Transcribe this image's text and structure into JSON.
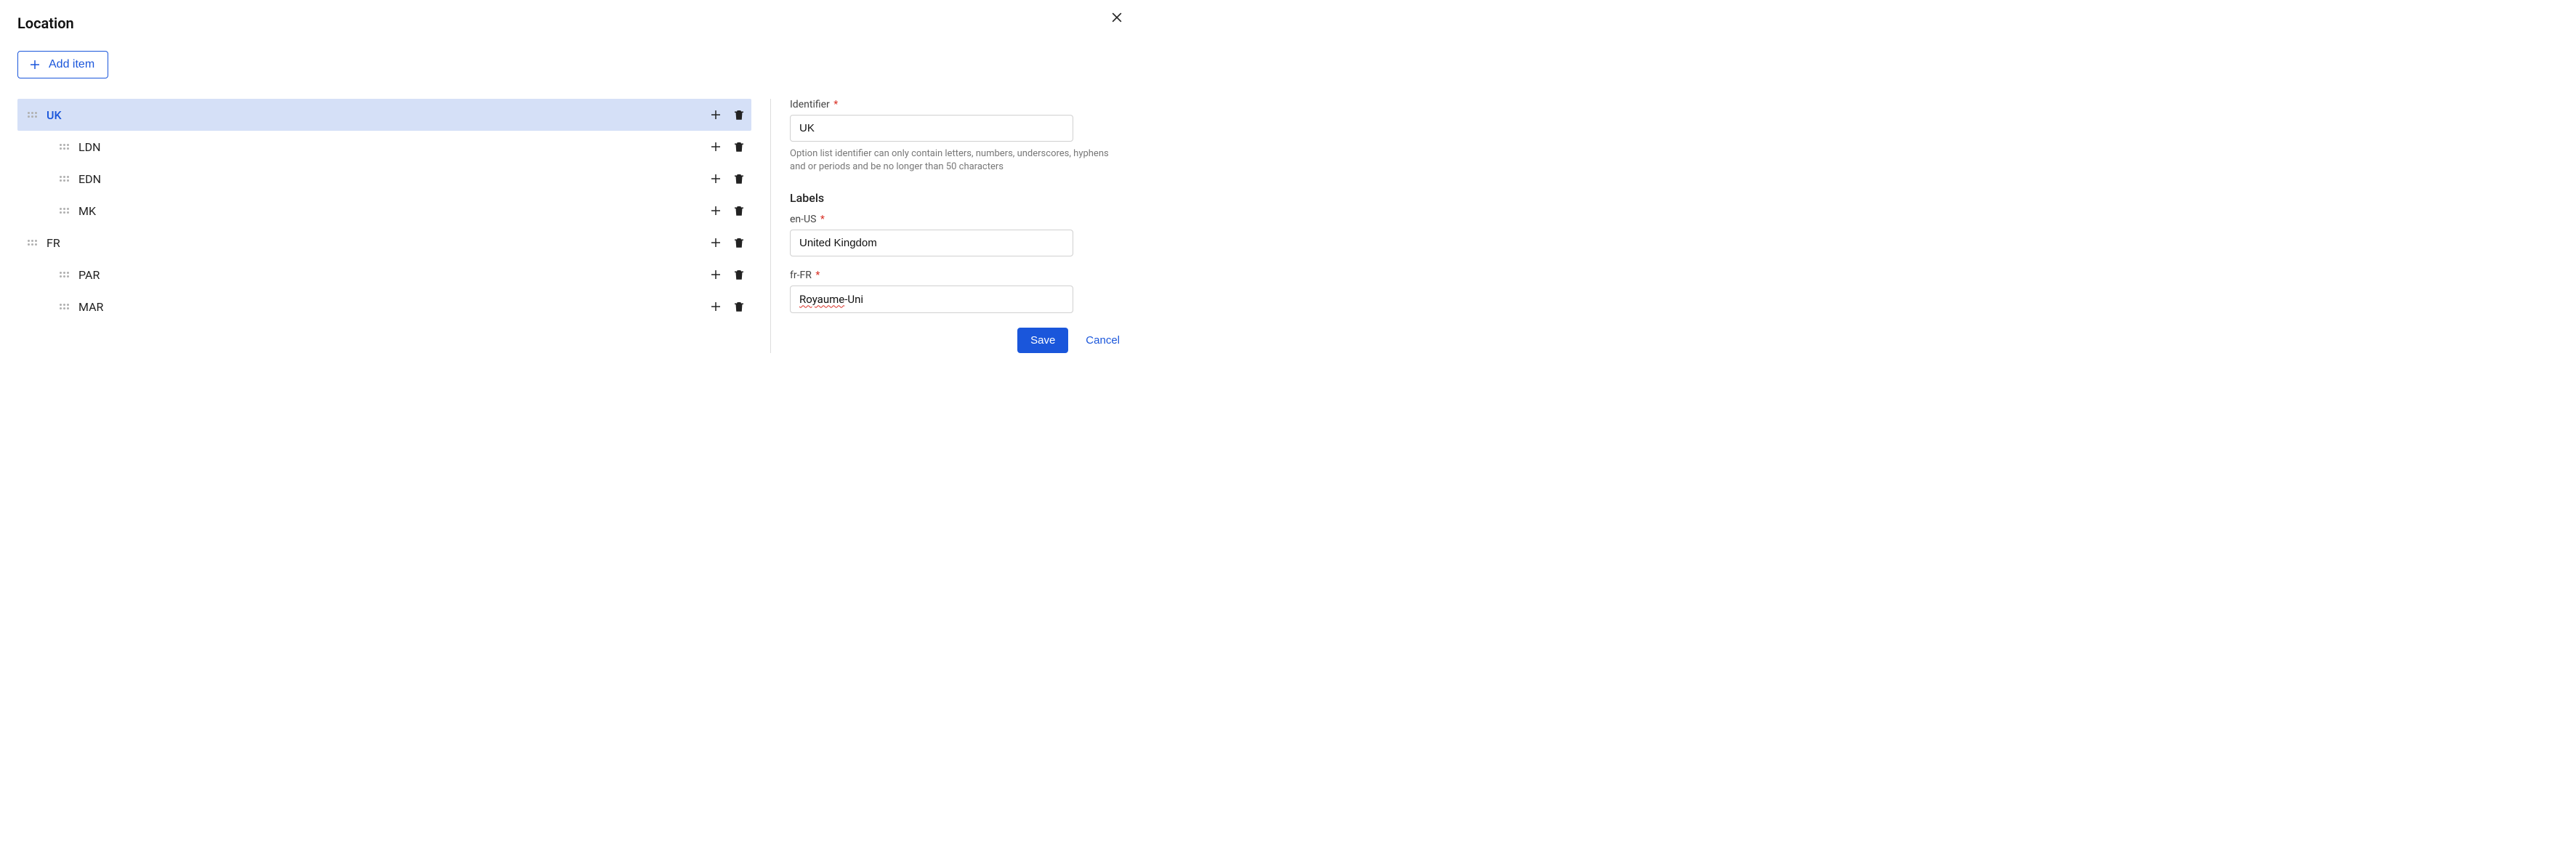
{
  "title": "Location",
  "add_item_label": "Add item",
  "tree": [
    {
      "id": "UK",
      "level": 0,
      "selected": true
    },
    {
      "id": "LDN",
      "level": 1,
      "selected": false
    },
    {
      "id": "EDN",
      "level": 1,
      "selected": false
    },
    {
      "id": "MK",
      "level": 1,
      "selected": false
    },
    {
      "id": "FR",
      "level": 0,
      "selected": false
    },
    {
      "id": "PAR",
      "level": 1,
      "selected": false
    },
    {
      "id": "MAR",
      "level": 1,
      "selected": false
    }
  ],
  "form": {
    "identifier_label": "Identifier",
    "identifier_value": "UK",
    "identifier_help": "Option list identifier can only contain letters, numbers, underscores, hyphens and or periods and be no longer than 50 characters",
    "labels_heading": "Labels",
    "locales": [
      {
        "code": "en-US",
        "required": true,
        "value": "United Kingdom",
        "spell_error_prefix": ""
      },
      {
        "code": "fr-FR",
        "required": true,
        "value": "Royaume-Uni",
        "spell_error_prefix": "Royaume"
      }
    ]
  },
  "buttons": {
    "save": "Save",
    "cancel": "Cancel"
  }
}
